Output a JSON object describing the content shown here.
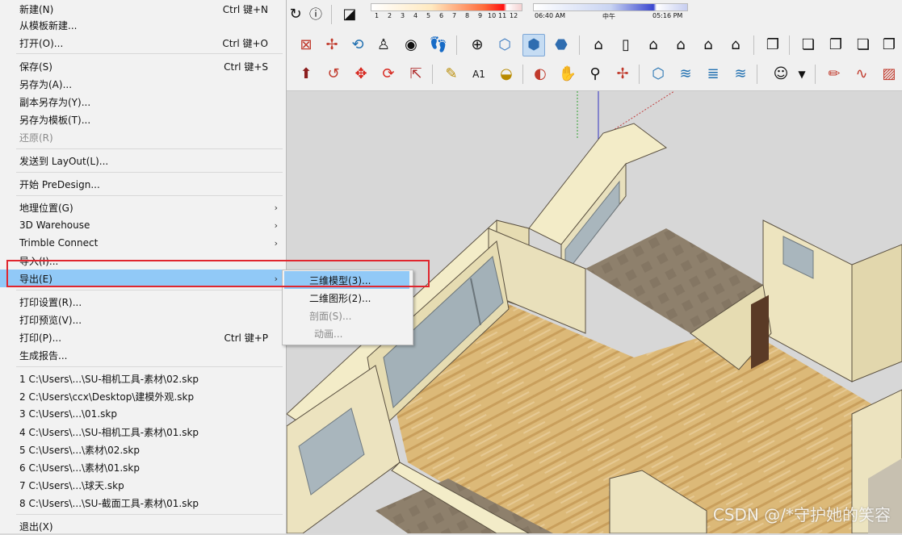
{
  "file_menu": {
    "items": [
      {
        "label": "新建(N)",
        "shortcut": "Ctrl 键+N"
      },
      {
        "label": "从模板新建..."
      },
      {
        "label": "打开(O)...",
        "shortcut": "Ctrl 键+O"
      },
      {
        "label": "保存(S)",
        "shortcut": "Ctrl 键+S"
      },
      {
        "label": "另存为(A)..."
      },
      {
        "label": "副本另存为(Y)..."
      },
      {
        "label": "另存为模板(T)..."
      },
      {
        "label": "还原(R)"
      },
      {
        "label": "发送到 LayOut(L)..."
      },
      {
        "label": "开始 PreDesign..."
      },
      {
        "label": "地理位置(G)"
      },
      {
        "label": "3D Warehouse"
      },
      {
        "label": "Trimble Connect"
      },
      {
        "label": "导入(I)..."
      },
      {
        "label": "导出(E)"
      },
      {
        "label": "打印设置(R)..."
      },
      {
        "label": "打印预览(V)..."
      },
      {
        "label": "打印(P)...",
        "shortcut": "Ctrl 键+P"
      },
      {
        "label": "生成报告..."
      },
      {
        "label": "1 C:\\Users\\...\\SU-相机工具-素材\\02.skp"
      },
      {
        "label": "2 C:\\Users\\ccx\\Desktop\\建模外观.skp"
      },
      {
        "label": "3 C:\\Users\\...\\01.skp"
      },
      {
        "label": "4 C:\\Users\\...\\SU-相机工具-素材\\01.skp"
      },
      {
        "label": "5 C:\\Users\\...\\素材\\02.skp"
      },
      {
        "label": "6 C:\\Users\\...\\素材\\01.skp"
      },
      {
        "label": "7 C:\\Users\\...\\球天.skp"
      },
      {
        "label": "8 C:\\Users\\...\\SU-截面工具-素材\\01.skp"
      },
      {
        "label": "退出(X)"
      }
    ]
  },
  "export_submenu": {
    "items": [
      {
        "label": "三维模型(3)..."
      },
      {
        "label": "二维图形(2)..."
      },
      {
        "label": "剖面(S)..."
      },
      {
        "label": "动画..."
      }
    ]
  },
  "shadow_controls": {
    "month_ticks": [
      "1",
      "2",
      "3",
      "4",
      "5",
      "6",
      "7",
      "8",
      "9",
      "10",
      "11",
      "12"
    ],
    "time_start": "06:40 AM",
    "time_mid": "中午",
    "time_end": "05:16 PM",
    "info_icon": "info-icon"
  },
  "toolbar_icons": {
    "row2": [
      "zoom-window-icon",
      "zoom-extents-icon",
      "previous-view-icon",
      "position-camera-icon",
      "look-around-icon",
      "walk-icon",
      "orbit-target-icon",
      "iso-view-icon",
      "top-view-icon",
      "front-view-icon",
      "house-3d-icon",
      "door-icon",
      "house-outline-icon",
      "house-roof-icon",
      "house-front-icon",
      "house-garage-icon",
      "layers-icon",
      "section-plane-icon",
      "section-fill-icon",
      "section-display-icon"
    ],
    "row3": [
      "push-pull-icon",
      "follow-me-icon",
      "move-icon",
      "rotate-icon",
      "scale-icon",
      "tape-measure-icon",
      "text-icon",
      "paint-bucket-icon",
      "orbit-icon",
      "pan-icon",
      "zoom-icon",
      "zoom-extents-icon",
      "component-icon",
      "tag-icon",
      "layer-stack-icon",
      "layer-settings-icon",
      "user-account-icon",
      "dropdown-icon",
      "pencil-icon",
      "freehand-icon",
      "eraser-icon"
    ]
  },
  "watermark": "CSDN @/*守护她的笑容",
  "colors": {
    "menu_bg": "#f2f2f2",
    "highlight": "#91c9f7",
    "annotation_red": "#e0262e",
    "wall": "#f1e9c5",
    "floor_wood": "#d9b774",
    "floor_tile": "#8d7f6c",
    "glass": "#a9b6bd"
  }
}
